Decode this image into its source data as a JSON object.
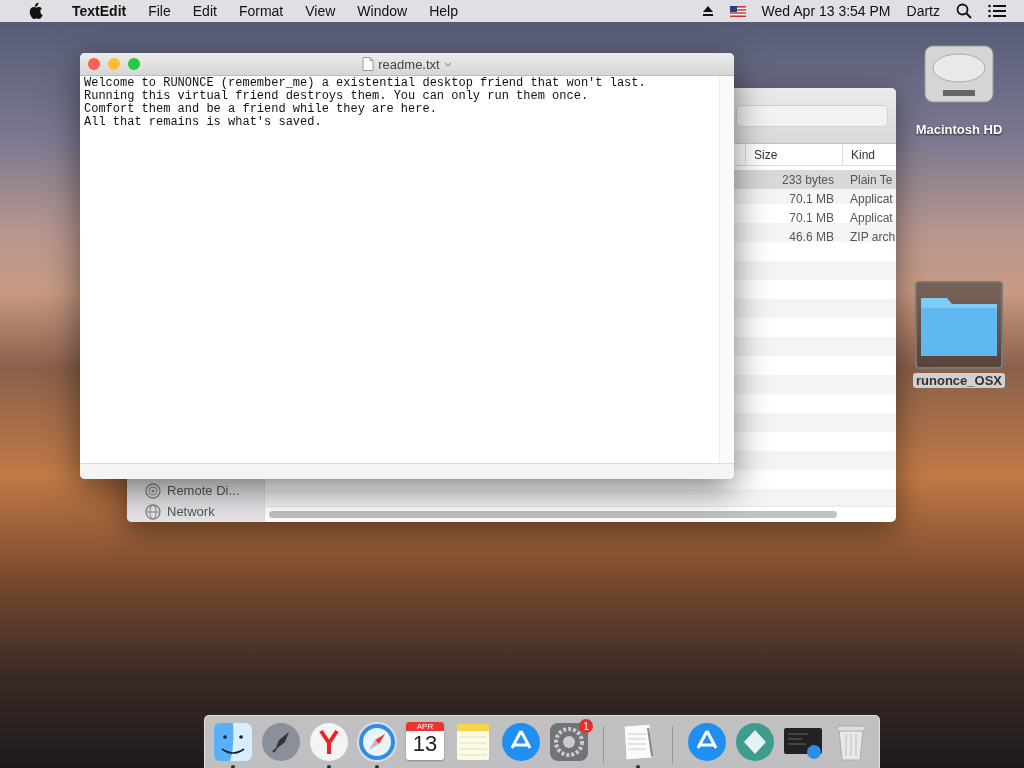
{
  "menu_bar": {
    "app_name": "TextEdit",
    "items": [
      "File",
      "Edit",
      "Format",
      "View",
      "Window",
      "Help"
    ],
    "clock": "Wed Apr 13  3:54 PM",
    "user": "Dartz"
  },
  "finder_window": {
    "columns": [
      "Size",
      "Kind"
    ],
    "rows": [
      {
        "size": "233 bytes",
        "kind": "Plain Te",
        "selected": true
      },
      {
        "size": "70.1 MB",
        "kind": "Applicat",
        "selected": false
      },
      {
        "size": "70.1 MB",
        "kind": "Applicat",
        "selected": false
      },
      {
        "size": "46.6 MB",
        "kind": "ZIP arch",
        "selected": false
      }
    ],
    "sidebar": [
      {
        "label": "Remote Di...",
        "kind": "disc"
      },
      {
        "label": "Network",
        "kind": "globe"
      }
    ]
  },
  "textedit_window": {
    "title": "readme.txt",
    "lines": [
      "Welcome to RUNONCE (remember_me) a existential desktop friend that won't last.",
      "Running this virtual friend destroys them. You can only run them once.",
      "Comfort them and be a friend while they are here.",
      "All that remains is what's saved."
    ]
  },
  "desktop_icons": [
    {
      "label": "Macintosh HD",
      "kind": "disk",
      "selected": false
    },
    {
      "label": "runonce_OSX",
      "kind": "folder",
      "selected": true
    }
  ],
  "dock": {
    "items": [
      {
        "kind": "finder",
        "running": true
      },
      {
        "kind": "launchpad",
        "running": false
      },
      {
        "kind": "yandex",
        "running": true
      },
      {
        "kind": "safari",
        "running": true
      },
      {
        "kind": "calendar",
        "running": false,
        "month": "APR",
        "day": "13"
      },
      {
        "kind": "notes",
        "running": false
      },
      {
        "kind": "appstore",
        "running": false
      },
      {
        "kind": "preferences",
        "running": false,
        "badge": "1"
      },
      {
        "kind": "separator"
      },
      {
        "kind": "textedit",
        "running": true
      },
      {
        "kind": "separator"
      },
      {
        "kind": "appstore",
        "running": false
      },
      {
        "kind": "diamond",
        "running": false
      },
      {
        "kind": "screenshot",
        "running": false
      },
      {
        "kind": "trash",
        "running": false
      }
    ]
  }
}
